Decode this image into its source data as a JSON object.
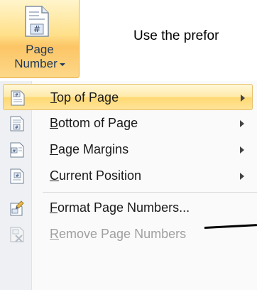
{
  "ribbon": {
    "page_number_line1": "Page",
    "page_number_line2": "Number"
  },
  "hint_text": "Use the prefor",
  "menu": {
    "items": [
      {
        "underline": "T",
        "rest": "op of Page",
        "has_submenu": true,
        "icon": "page-top-icon",
        "state": "highlighted"
      },
      {
        "underline": "B",
        "rest": "ottom of Page",
        "has_submenu": true,
        "icon": "page-bottom-icon",
        "state": "normal"
      },
      {
        "underline": "P",
        "rest": "age Margins",
        "has_submenu": true,
        "icon": "page-margins-icon",
        "state": "normal"
      },
      {
        "underline": "C",
        "rest": "urrent Position",
        "has_submenu": true,
        "icon": "current-position-icon",
        "state": "normal"
      },
      {
        "underline": "F",
        "rest": "ormat Page Numbers...",
        "has_submenu": false,
        "icon": "format-page-numbers-icon",
        "state": "normal"
      },
      {
        "underline": "R",
        "rest": "emove Page Numbers",
        "has_submenu": false,
        "icon": "remove-page-numbers-icon",
        "state": "disabled"
      }
    ]
  },
  "colors": {
    "ribbon_highlight": "#fcc565",
    "menu_hover": "#ffe9a8",
    "label_text": "#1e395b",
    "disabled_text": "#a0a0a0"
  }
}
